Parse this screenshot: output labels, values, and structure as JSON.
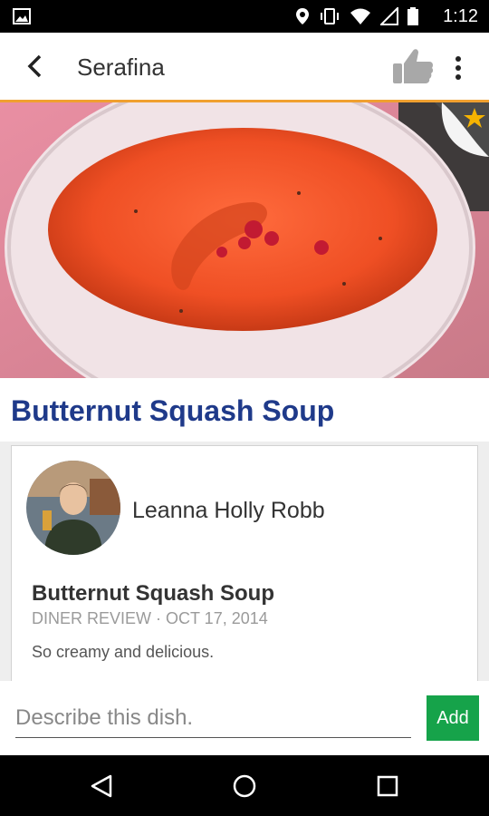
{
  "status_bar": {
    "time": "1:12",
    "icons": [
      "image-icon",
      "location-icon",
      "vibrate-icon",
      "wifi-icon",
      "signal-icon",
      "battery-icon"
    ]
  },
  "app_bar": {
    "title": "Serafina",
    "icons": [
      "back-arrow-icon",
      "thumbs-up-icon",
      "more-vert-icon"
    ]
  },
  "hero": {
    "image_subject": "bowl of butternut squash soup",
    "favorite_icon": "star-icon"
  },
  "dish": {
    "title": "Butternut Squash Soup"
  },
  "review": {
    "author": "Leanna Holly Robb",
    "title": "Butternut Squash Soup",
    "meta": "DINER REVIEW · OCT 17, 2014",
    "text": "So creamy and delicious."
  },
  "composer": {
    "placeholder": "Describe this dish.",
    "add_label": "Add"
  },
  "nav_bar": {
    "icons": [
      "nav-back-icon",
      "nav-home-icon",
      "nav-recents-icon"
    ]
  },
  "colors": {
    "accent": "#f0a030",
    "title_blue": "#1f3a8a",
    "add_green": "#16a34a"
  }
}
